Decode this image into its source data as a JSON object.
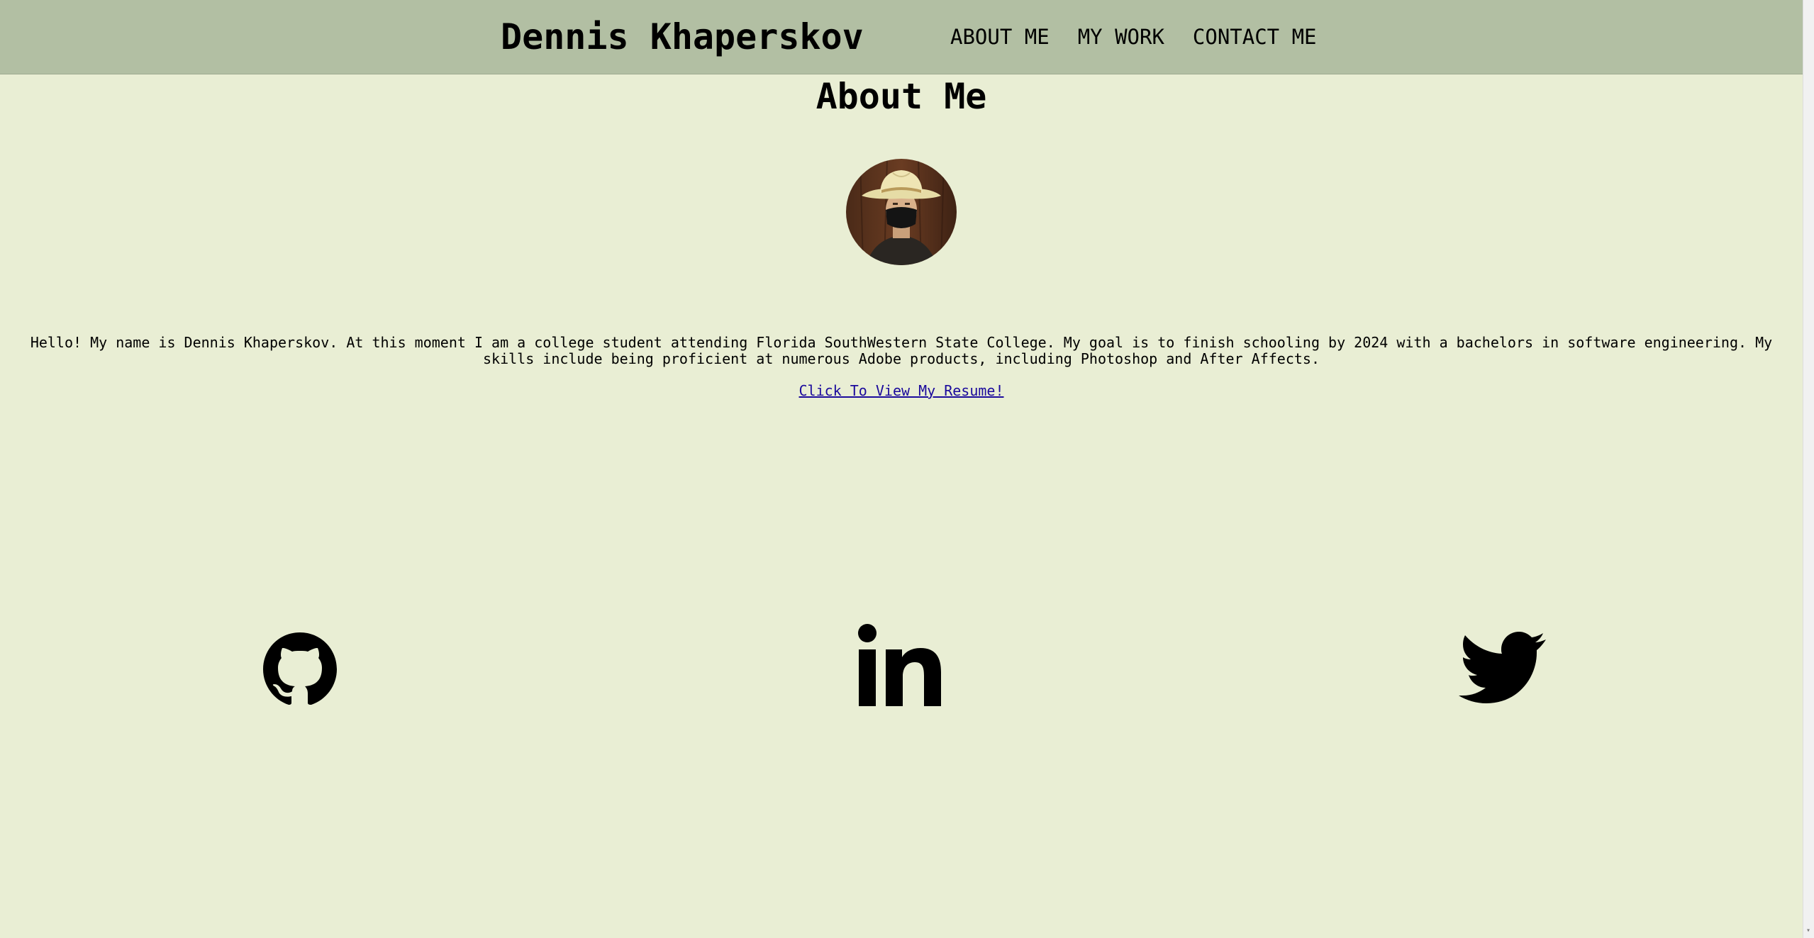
{
  "header": {
    "brand": "Dennis Khaperskov",
    "nav": [
      {
        "label": "ABOUT ME"
      },
      {
        "label": "MY WORK"
      },
      {
        "label": "CONTACT ME"
      }
    ]
  },
  "main": {
    "title": "About Me",
    "bio": "Hello! My name is Dennis Khaperskov. At this moment I am a college student attending Florida SouthWestern State College. My goal is to finish schooling by 2024 with a bachelors in software engineering. My skills include being proficient at numerous Adobe products, including Photoshop and After Affects.",
    "resume_link": "Click To View My Resume!"
  },
  "social": [
    {
      "icon": "github-icon"
    },
    {
      "icon": "linkedin-icon"
    },
    {
      "icon": "twitter-icon"
    }
  ],
  "colors": {
    "header_bg": "#b2bfa3",
    "page_bg": "#e9eed4",
    "link": "#1b0a9c"
  }
}
